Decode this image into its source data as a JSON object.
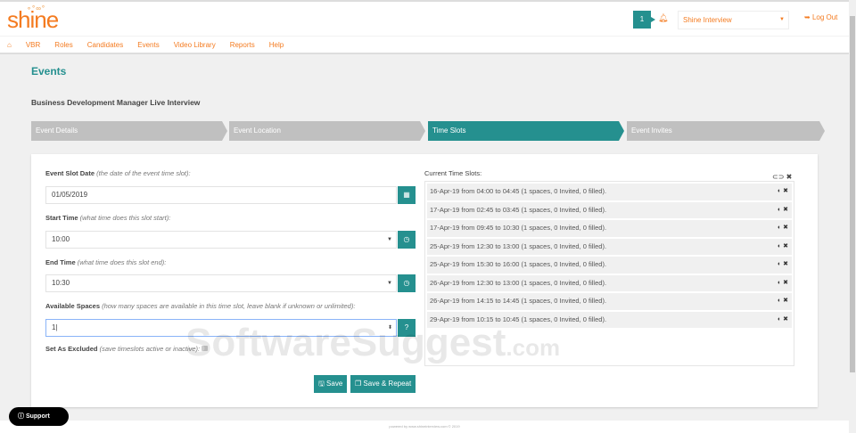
{
  "header": {
    "logo": "shine",
    "notification_count": "1",
    "account_select": "Shine Interview",
    "logout": "Log Out"
  },
  "nav": [
    "VBR",
    "Roles",
    "Candidates",
    "Events",
    "Video Library",
    "Reports",
    "Help"
  ],
  "page_title": "Events",
  "event_name": "Business Development Manager Live Interview",
  "steps": [
    "Event Details",
    "Event Location",
    "Time Slots",
    "Event Invites"
  ],
  "form": {
    "date_label": "Event Slot Date",
    "date_hint": "(the date of the event time slot):",
    "date_value": "01/05/2019",
    "start_label": "Start Time",
    "start_hint": "(what time does this slot start):",
    "start_value": "10:00",
    "end_label": "End Time",
    "end_hint": "(what time does this slot end):",
    "end_value": "10:30",
    "spaces_label": "Available Spaces",
    "spaces_hint": "(how many spaces are available in this time slot, leave blank if unknown or unlimited):",
    "spaces_value": "1",
    "excluded_label": "Set As Excluded",
    "excluded_hint": "(save timeslots active or inactive):",
    "help_btn": "?",
    "save": "Save",
    "save_repeat": "Save & Repeat"
  },
  "slots_title": "Current Time Slots:",
  "slots": [
    "16-Apr-19 from 04:00 to 04:45 (1 spaces, 0 Invited, 0 filled).",
    "17-Apr-19 from 02:45 to 03:45 (1 spaces, 0 Invited, 0 filled).",
    "17-Apr-19 from 09:45 to 10:30 (1 spaces, 0 Invited, 0 filled).",
    "25-Apr-19 from 12:30 to 13:00 (1 spaces, 0 Invited, 0 filled).",
    "25-Apr-19 from 15:30 to 16:00 (1 spaces, 0 Invited, 0 filled).",
    "26-Apr-19 from 12:30 to 13:00 (1 spaces, 0 Invited, 0 filled).",
    "26-Apr-19 from 14:15 to 14:45 (1 spaces, 0 Invited, 0 filled).",
    "29-Apr-19 from 10:15 to 10:45 (1 spaces, 0 Invited, 0 filled)."
  ],
  "support": "Support",
  "footer": "powered by www.shineinterview.com © 2019",
  "watermark": "SoftwareSuggest",
  "watermark_suffix": ".com",
  "colors": {
    "accent": "#25908f",
    "brand": "#f47b20"
  }
}
